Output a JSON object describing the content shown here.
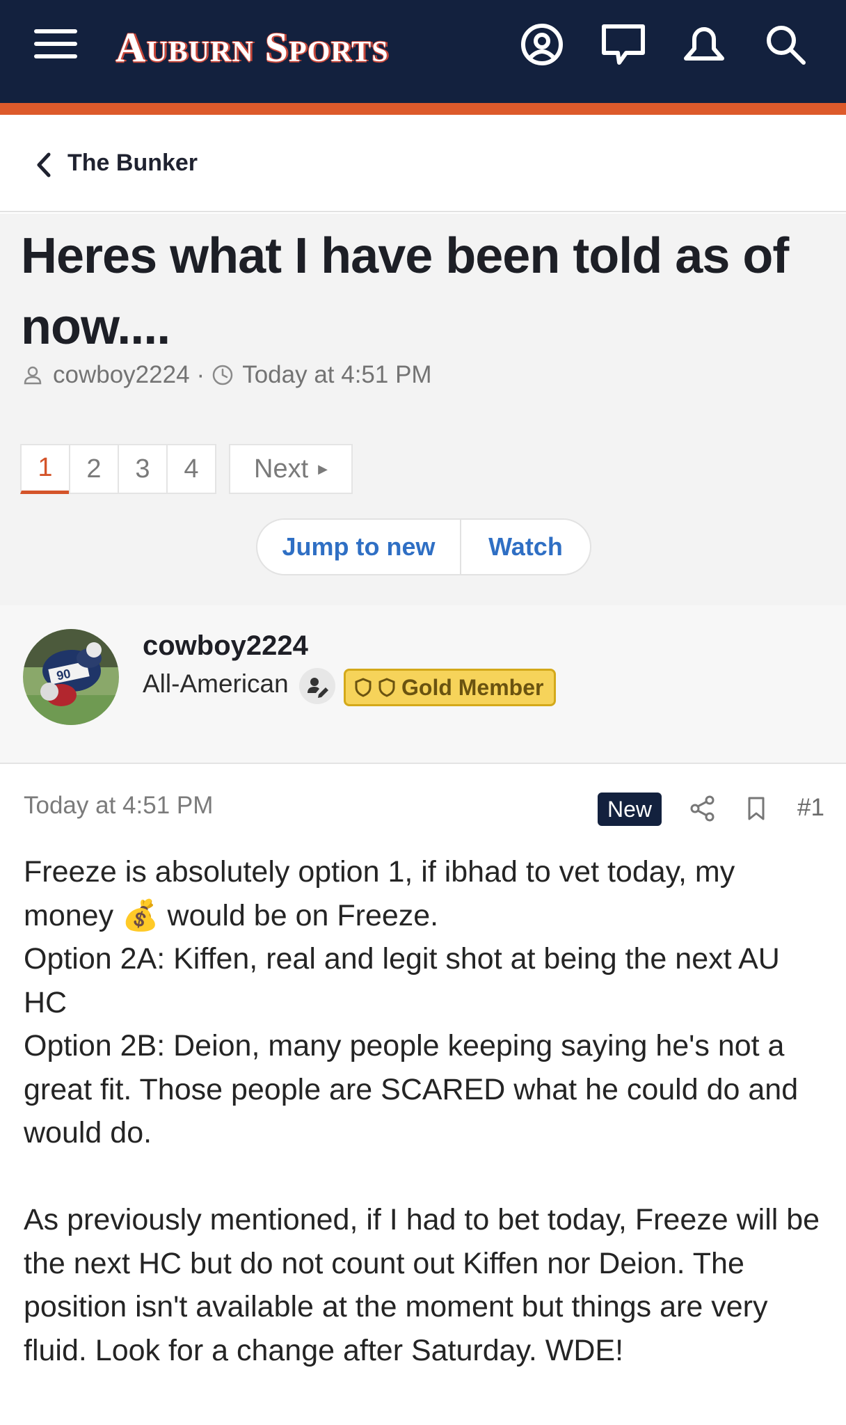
{
  "header": {
    "site_name": "Auburn Sports",
    "icons": [
      "menu-icon",
      "account-icon",
      "messages-icon",
      "alerts-icon",
      "search-icon"
    ],
    "colors": {
      "navy": "#13213e",
      "orange": "#dd5a2b"
    }
  },
  "breadcrumb": {
    "label": "The Bunker"
  },
  "thread": {
    "title": "Heres what I have been told as of now....",
    "author": "cowboy2224",
    "separator": "·",
    "timestamp": "Today at 4:51 PM",
    "pagination": {
      "pages": [
        "1",
        "2",
        "3",
        "4"
      ],
      "current": "1",
      "next_label": "Next"
    },
    "actions": {
      "jump_label": "Jump to new",
      "watch_label": "Watch"
    }
  },
  "user": {
    "name": "cowboy2224",
    "title": "All-American",
    "badge": "Gold Member"
  },
  "post": {
    "timestamp": "Today at 4:51 PM",
    "new_label": "New",
    "number": "#1",
    "body_line1_a": "Freeze is absolutely option 1, if ibhad to vet today, my money ",
    "body_emoji": "💰",
    "body_line1_b": " would be on Freeze.",
    "option_2a": "Option 2A: Kiffen, real and legit shot at being the next AU HC",
    "option_2b": "Option 2B: Deion, many people keeping saying he's not a great fit. Those people are SCARED what he could do and would do.",
    "paragraph2": "As previously mentioned, if I had to bet today, Freeze will be the next HC but do not count out Kiffen nor Deion. The position isn't available at the moment but things are very fluid. Look for a change after Saturday. WDE!"
  }
}
